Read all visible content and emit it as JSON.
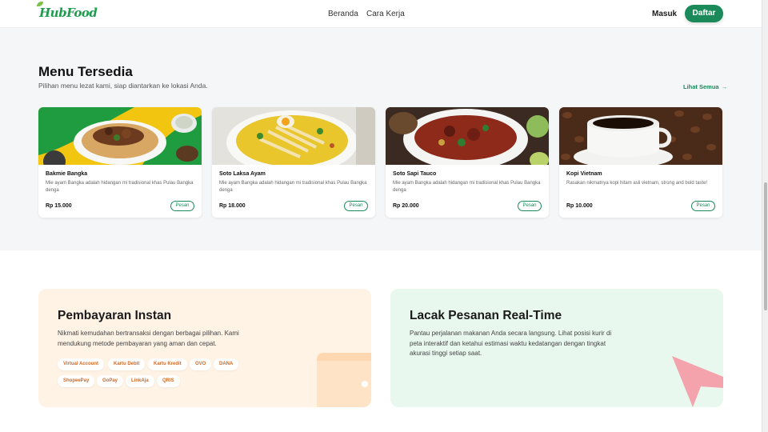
{
  "header": {
    "logo": "HubFood",
    "nav": [
      "Beranda",
      "Cara Kerja"
    ],
    "login_label": "Masuk",
    "signup_label": "Daftar"
  },
  "menu": {
    "title": "Menu Tersedia",
    "subtitle": "Pilihan menu lezat kami, siap diantarkan ke lokasi Anda.",
    "see_all": "Lihat Semua",
    "items": [
      {
        "name": "Bakmie Bangka",
        "desc": "Mie ayam Bangka adalah hidangan mi tradisional khas Pulau Bangka denga",
        "price": "Rp 15.000",
        "button": "Pesan"
      },
      {
        "name": "Soto Laksa Ayam",
        "desc": "Mie ayam Bangka adalah hidangan mi tradisional khas Pulau Bangka denga",
        "price": "Rp 18.000",
        "button": "Pesan"
      },
      {
        "name": "Soto Sapi Tauco",
        "desc": "Mie ayam Bangka adalah hidangan mi tradisional khas Pulau Bangka denga",
        "price": "Rp 20.000",
        "button": "Pesan"
      },
      {
        "name": "Kopi Vietnam",
        "desc": "Rasakan nikmatnya kopi hitam asli vietnam, strong and bold taste!",
        "price": "Rp 10.000",
        "button": "Pesan"
      }
    ]
  },
  "features": {
    "payment": {
      "title": "Pembayaran Instan",
      "desc": "Nikmati kemudahan bertransaksi dengan berbagai pilihan. Kami mendukung metode pembayaran yang aman dan cepat.",
      "methods": [
        "Virtual Account",
        "Kartu Debit",
        "Kartu Kredit",
        "OVO",
        "DANA",
        "ShopeePay",
        "GoPay",
        "LinkAja",
        "QRIS"
      ]
    },
    "tracking": {
      "title": "Lacak Pesanan Real-Time",
      "desc": "Pantau perjalanan makanan Anda secara langsung. Lihat posisi kurir di peta interaktif dan ketahui estimasi waktu kedatangan dengan tingkat akurasi tinggi setiap saat."
    }
  },
  "colors": {
    "brand_green": "#1b8a5a",
    "chip_text": "#d06a24",
    "payment_bg": "#fff3e6",
    "tracking_bg": "#e9f8ef",
    "cursor_pink": "#f4a3ad"
  }
}
